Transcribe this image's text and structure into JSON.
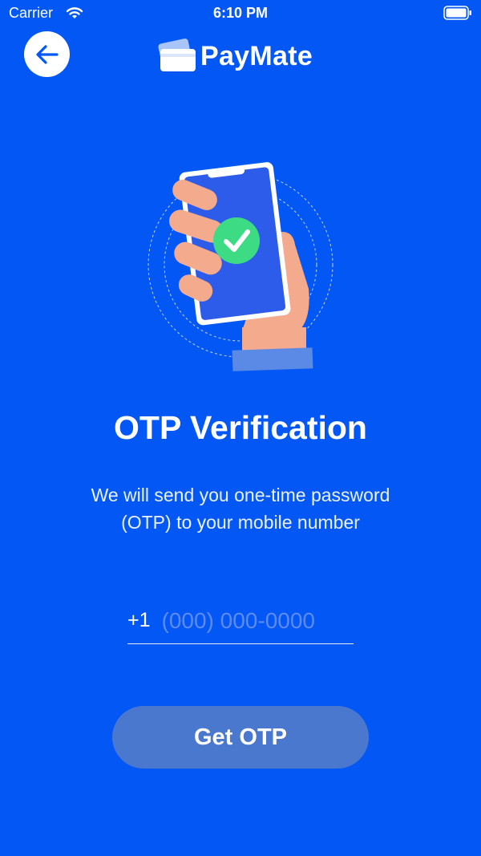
{
  "status_bar": {
    "carrier": "Carrier",
    "time": "6:10 PM"
  },
  "header": {
    "app_name": "PayMate",
    "icons": {
      "back": "arrow-left-icon",
      "logo": "wallet-card-icon"
    }
  },
  "illustration": {
    "icon": "phone-verified-icon",
    "check_color": "#3DDC84"
  },
  "content": {
    "title": "OTP Verification",
    "subtitle_line1": "We will send you one-time password",
    "subtitle_line2": "(OTP) to your mobile number"
  },
  "form": {
    "country_code": "+1",
    "phone_value": "",
    "phone_placeholder": "(000) 000-0000",
    "button_label": "Get OTP"
  },
  "colors": {
    "background": "#0357F5",
    "button": "#4A78CE"
  }
}
